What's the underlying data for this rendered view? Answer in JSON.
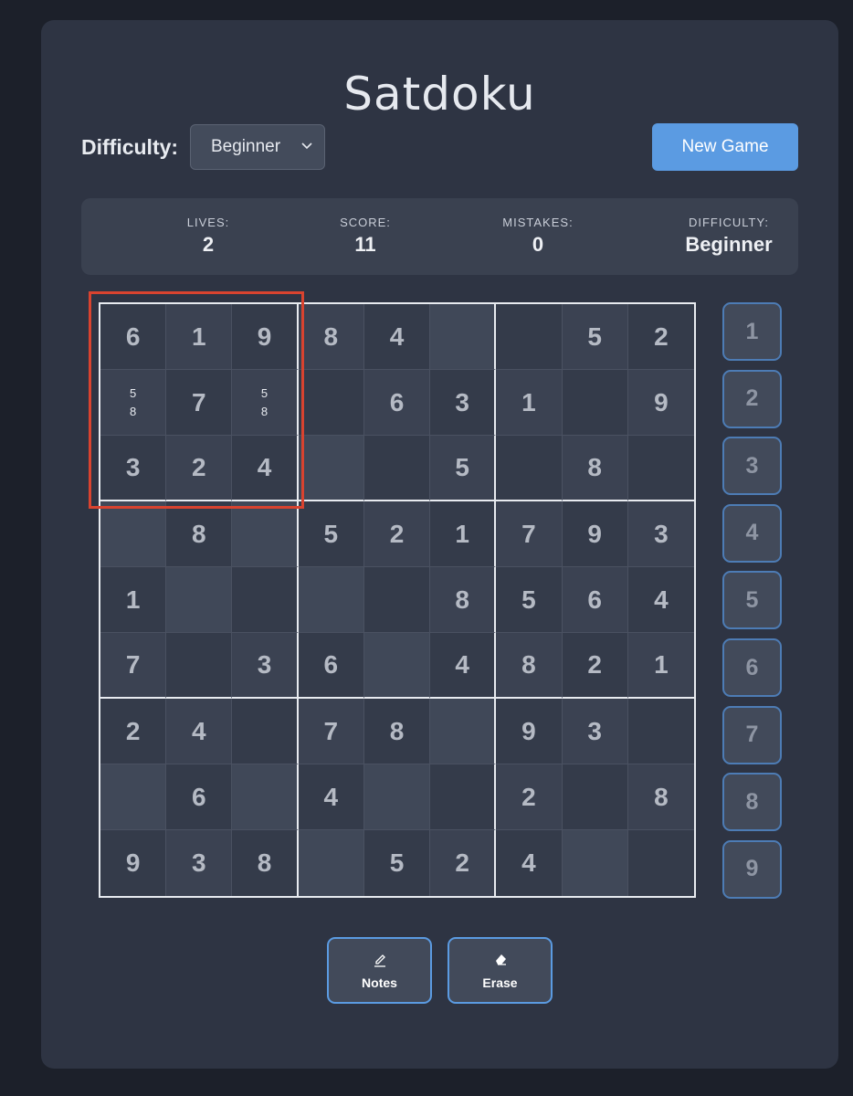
{
  "title": "Satdoku",
  "difficulty_control": {
    "label": "Difficulty:",
    "selected": "Beginner"
  },
  "new_game_label": "New Game",
  "stats": {
    "lives": {
      "label": "LIVES:",
      "value": "2"
    },
    "score": {
      "label": "SCORE:",
      "value": "11"
    },
    "mistakes": {
      "label": "MISTAKES:",
      "value": "0"
    },
    "difficulty": {
      "label": "DIFFICULTY:",
      "value": "Beginner"
    }
  },
  "board": [
    [
      "6",
      "1",
      "9",
      "8",
      "4",
      "",
      "",
      "5",
      "2"
    ],
    [
      "N:5,8",
      "7",
      "N:5,8",
      "",
      "6",
      "3",
      "1",
      "",
      "9"
    ],
    [
      "3",
      "2",
      "4",
      "",
      "",
      "5",
      "",
      "8",
      ""
    ],
    [
      "",
      "8",
      "",
      "5",
      "2",
      "1",
      "7",
      "9",
      "3"
    ],
    [
      "1",
      "",
      "",
      "",
      "",
      "8",
      "5",
      "6",
      "4"
    ],
    [
      "7",
      "",
      "3",
      "6",
      "",
      "4",
      "8",
      "2",
      "1"
    ],
    [
      "2",
      "4",
      "",
      "7",
      "8",
      "",
      "9",
      "3",
      ""
    ],
    [
      "",
      "6",
      "",
      "4",
      "",
      "",
      "2",
      "",
      "8"
    ],
    [
      "9",
      "3",
      "8",
      "",
      "5",
      "2",
      "4",
      "",
      ""
    ]
  ],
  "number_pad": [
    "1",
    "2",
    "3",
    "4",
    "5",
    "6",
    "7",
    "8",
    "9"
  ],
  "tools": {
    "notes": {
      "label": "Notes",
      "icon": "pencil-icon"
    },
    "erase": {
      "label": "Erase",
      "icon": "eraser-icon"
    }
  },
  "colors": {
    "accent": "#5b9be2",
    "highlight": "#d9432f",
    "panel": "#2e3443"
  }
}
